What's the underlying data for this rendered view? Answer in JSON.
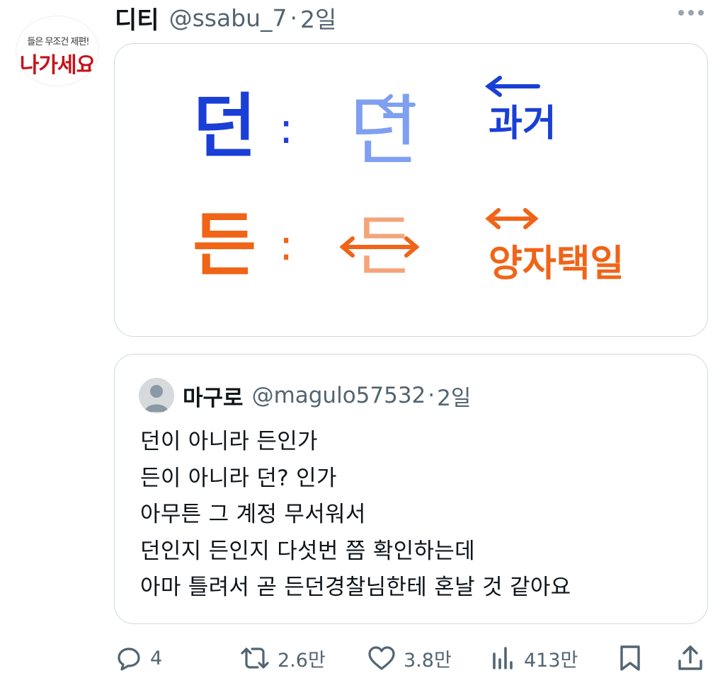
{
  "author": {
    "display_name": "디티",
    "handle": "@ssabu_7",
    "separator": "·",
    "time": "2일",
    "avatar_text_top": "들은 무조건 제편!",
    "avatar_text_main": "나가세요"
  },
  "media": {
    "row1": {
      "left": "던",
      "colon": ":",
      "middle": "던",
      "meaning": "과거"
    },
    "row2": {
      "left": "든",
      "colon": ":",
      "middle": "든",
      "meaning": "양자택일"
    },
    "colors": {
      "blue": "#1a3fd6",
      "light_blue": "#7f9ff0",
      "orange": "#f06418",
      "light_orange": "#f5a47a"
    }
  },
  "quote": {
    "display_name": "마구로",
    "handle": "@magulo57532",
    "separator": "·",
    "time": "2일",
    "lines": [
      "던이 아니라 든인가",
      "든이 아니라 던? 인가",
      "아무튼 그 계정 무서워서",
      "던인지 든인지 다섯번 쯤 확인하는데",
      "아마 틀려서 곧 든던경찰님한테 혼날 것 같아요"
    ]
  },
  "actions": {
    "reply": {
      "icon": "reply-icon",
      "count": "4"
    },
    "retweet": {
      "icon": "retweet-icon",
      "count": "2.6만"
    },
    "like": {
      "icon": "heart-icon",
      "count": "3.8만"
    },
    "views": {
      "icon": "views-chart-icon",
      "count": "413만"
    },
    "bookmark": {
      "icon": "bookmark-icon"
    },
    "share": {
      "icon": "share-icon"
    }
  },
  "colors": {
    "secondary_text": "#536471",
    "border": "#cfd9de",
    "primary_text": "#0f1419",
    "avatar_red": "#c3141c"
  }
}
